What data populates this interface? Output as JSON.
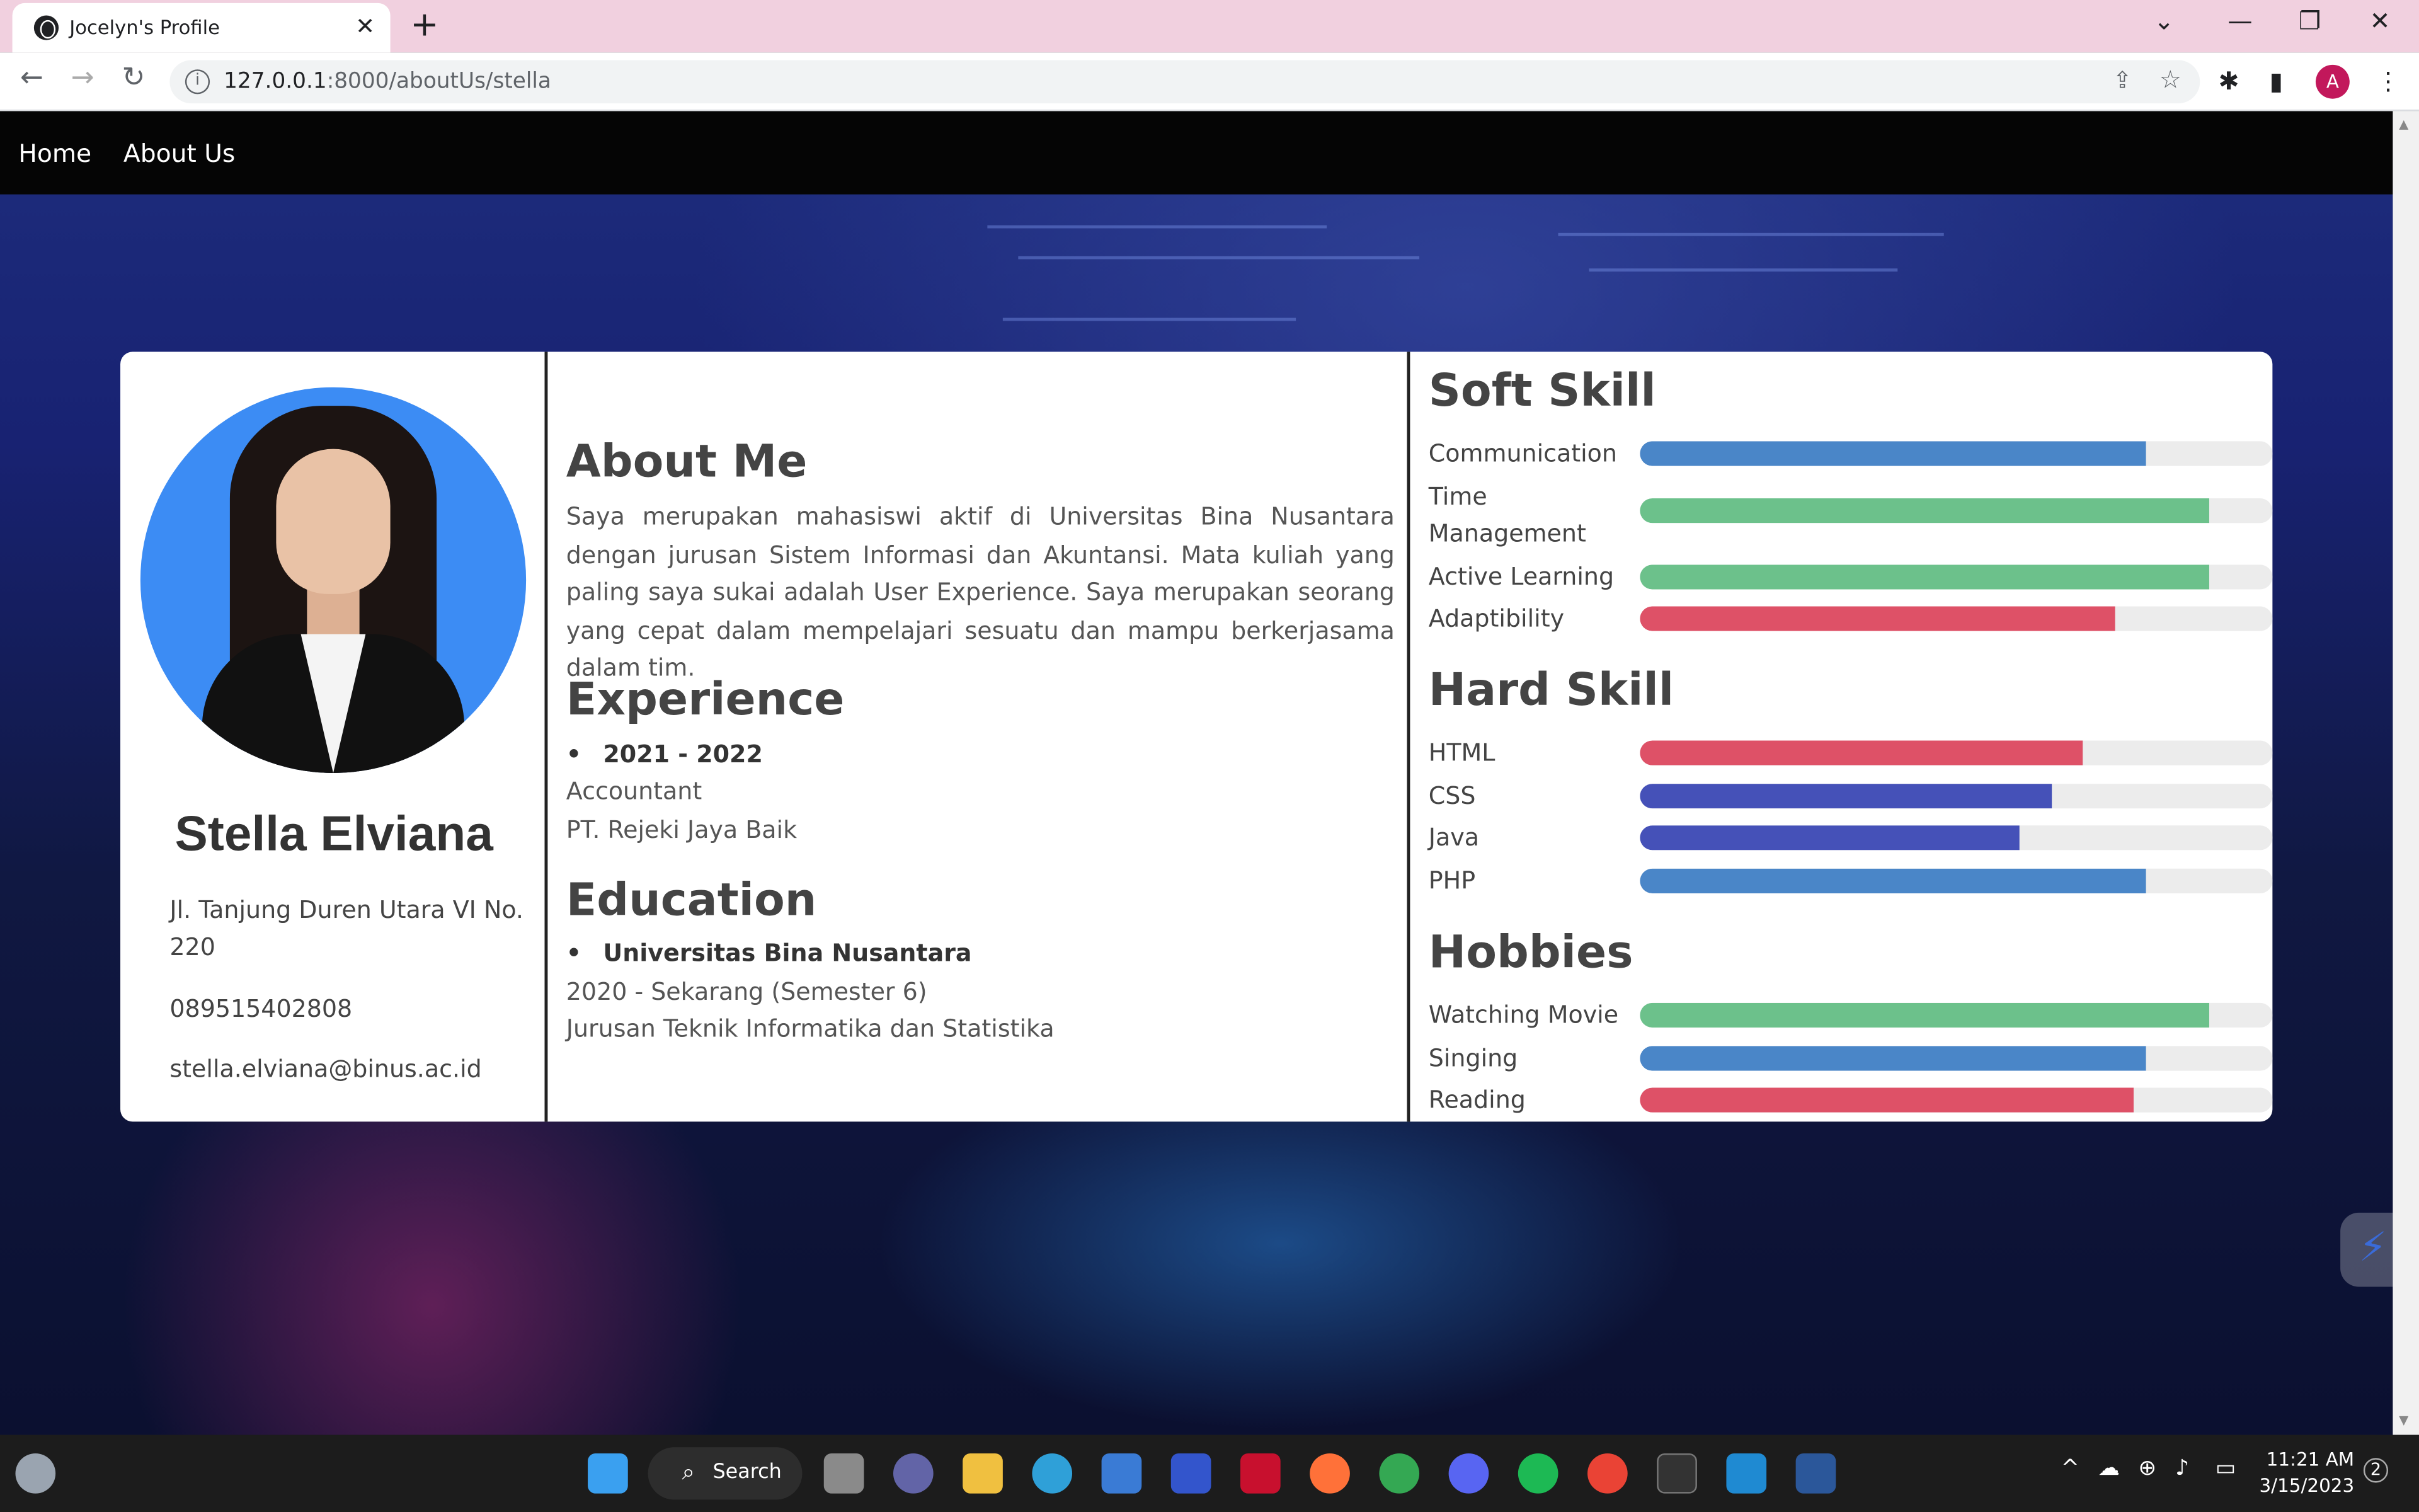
{
  "browser": {
    "tab_title": "Jocelyn's Profile",
    "url_host": "127.0.0.1",
    "url_path": ":8000/aboutUs/stella",
    "profile_initial": "A"
  },
  "nav": {
    "home": "Home",
    "about": "About Us"
  },
  "profile": {
    "name": "Stella Elviana",
    "address": "Jl. Tanjung Duren Utara VI No. 220",
    "phone": "089515402808",
    "email": "stella.elviana@binus.ac.id"
  },
  "about": {
    "heading": "About Me",
    "text": "Saya merupakan mahasiswi aktif di Universitas Bina Nusantara dengan jurusan Sistem Informasi dan Akuntansi. Mata kuliah yang paling saya sukai adalah User Experience. Saya merupakan seorang yang cepat dalam mempelajari sesuatu dan mampu berkerjasama dalam tim."
  },
  "experience": {
    "heading": "Experience",
    "period": "2021 - 2022",
    "role": "Accountant",
    "company": "PT. Rejeki Jaya Baik"
  },
  "education": {
    "heading": "Education",
    "school": "Universitas Bina Nusantara",
    "period": "2020 - Sekarang (Semester 6)",
    "major": "Jurusan Teknik Informatika dan Statistika"
  },
  "soft_skill": {
    "heading": "Soft Skill",
    "items": [
      {
        "label": "Communication",
        "level": 0.8,
        "color": "#4a86c8"
      },
      {
        "label": "Time Management",
        "level": 0.9,
        "color": "#6cc18b"
      },
      {
        "label": "Active Learning",
        "level": 0.9,
        "color": "#6cc18b"
      },
      {
        "label": "Adaptibility",
        "level": 0.75,
        "color": "#de5167"
      }
    ]
  },
  "hard_skill": {
    "heading": "Hard Skill",
    "items": [
      {
        "label": "HTML",
        "level": 0.7,
        "color": "#de5167"
      },
      {
        "label": "CSS",
        "level": 0.65,
        "color": "#4551b8"
      },
      {
        "label": "Java",
        "level": 0.6,
        "color": "#4551b8"
      },
      {
        "label": "PHP",
        "level": 0.8,
        "color": "#4a86c8"
      }
    ]
  },
  "hobbies": {
    "heading": "Hobbies",
    "items": [
      {
        "label": "Watching Movie",
        "level": 0.9,
        "color": "#6cc18b"
      },
      {
        "label": "Singing",
        "level": 0.8,
        "color": "#4a86c8"
      },
      {
        "label": "Reading",
        "level": 0.78,
        "color": "#de5167"
      }
    ]
  },
  "taskbar": {
    "search_label": "Search",
    "time": "11:21 AM",
    "date": "3/15/2023",
    "notification_count": "2"
  }
}
